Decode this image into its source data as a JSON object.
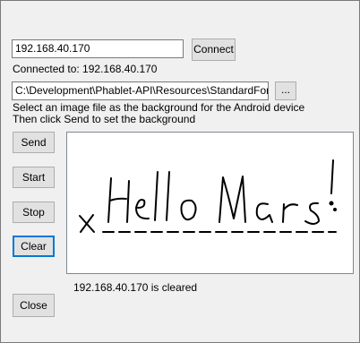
{
  "ip_field": {
    "value": "192.168.40.170"
  },
  "connect_button": "Connect",
  "connection_status": "Connected to:  192.168.40.170",
  "file_path": {
    "value": "C:\\Development\\Phablet-API\\Resources\\StandardForm.bmp"
  },
  "browse_button": "...",
  "instructions": {
    "line1": "Select an image file as the background for the Android device",
    "line2": "Then click  Send to set the background"
  },
  "buttons": {
    "send": "Send",
    "start": "Start",
    "stop": "Stop",
    "clear": "Clear",
    "close": "Close"
  },
  "signature_canvas": {
    "handwritten_text": "Hello Mars!",
    "mark": "X"
  },
  "status_message": "192.168.40.170 is cleared"
}
